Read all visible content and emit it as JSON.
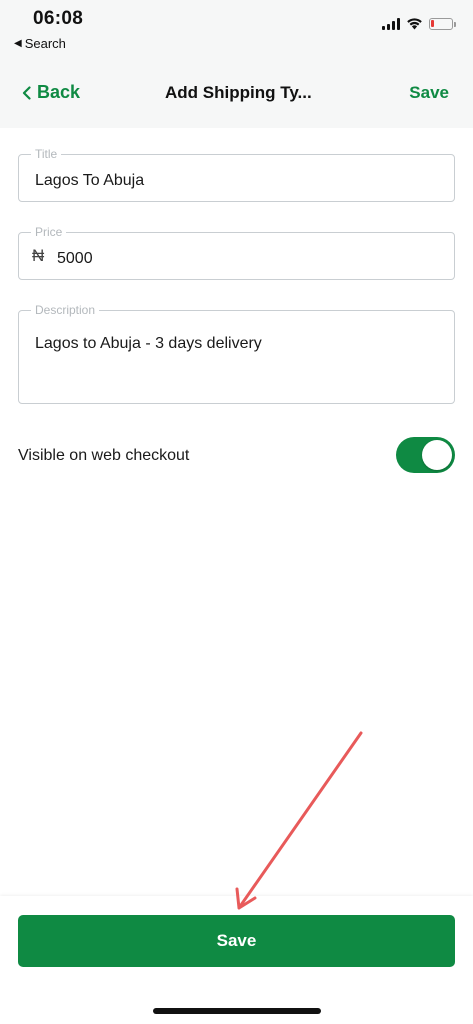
{
  "status_bar": {
    "time": "06:08",
    "back_app_label": "Search",
    "back_app_icon": "triangle-left-icon",
    "battery_color": "#e53935"
  },
  "nav": {
    "back_label": "Back",
    "title": "Add Shipping Ty...",
    "save_label": "Save"
  },
  "form": {
    "title_field": {
      "label": "Title",
      "value": "Lagos To Abuja"
    },
    "price_field": {
      "label": "Price",
      "currency_symbol": "₦",
      "value": "5000"
    },
    "description_field": {
      "label": "Description",
      "value": "Lagos to Abuja - 3 days delivery"
    },
    "visible_toggle": {
      "label": "Visible on web checkout",
      "on": true
    }
  },
  "footer": {
    "save_button_label": "Save"
  },
  "colors": {
    "accent": "#0f8a43",
    "annotation_arrow": "#e85a5a"
  }
}
